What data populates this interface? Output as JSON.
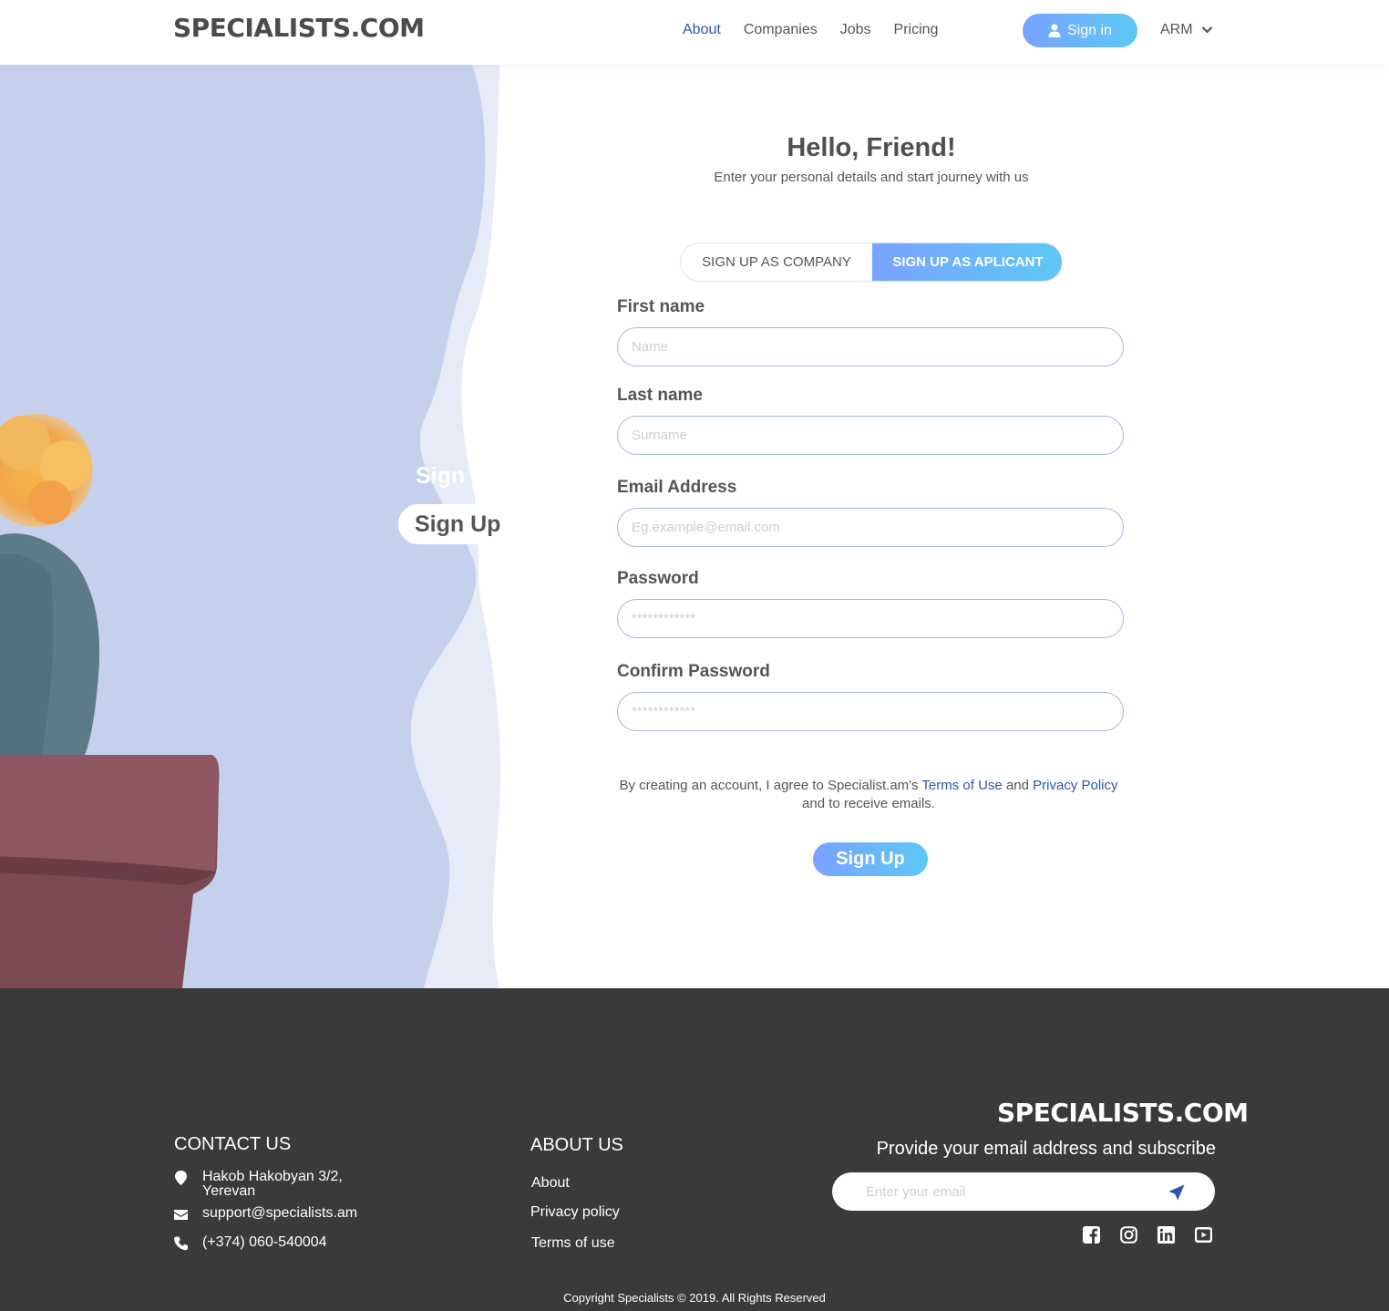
{
  "header": {
    "logo": "SPECIALISTS.COM",
    "nav": [
      "About",
      "Companies",
      "Jobs",
      "Pricing"
    ],
    "active_nav": "About",
    "signin_label": "Sign in",
    "language": "ARM"
  },
  "side_panel": {
    "signin_label": "Sign In",
    "signup_label": "Sign Up"
  },
  "form": {
    "title": "Hello, Friend!",
    "subtitle": "Enter your personal details and start journey with us",
    "tab_company": "SIGN UP AS COMPANY",
    "tab_applicant": "SIGN UP AS APLICANT",
    "first_name_label": "First name",
    "first_name_placeholder": "Name",
    "last_name_label": "Last name",
    "last_name_placeholder": "Surname",
    "email_label": "Email Address",
    "email_placeholder": "Eg.example@email.com",
    "password_label": "Password",
    "password_placeholder": "************",
    "confirm_label": "Confirm Password",
    "confirm_placeholder": "************",
    "agree_text_1": "By creating an account, I agree to Specialist.am's ",
    "terms_link": "Terms of Use",
    "agree_text_2": " and ",
    "privacy_link": "Privacy Policy",
    "agree_text_3": " and to receive emails.",
    "submit_label": "Sign Up"
  },
  "footer": {
    "contact_heading": "CONTACT US",
    "address_line1": "Hakob Hakobyan 3/2,",
    "address_line2": "Yerevan",
    "email": "support@specialists.am",
    "phone": "(+374) 060-540004",
    "about_heading": "ABOUT US",
    "about_links": [
      "About",
      "Privacy policy",
      "Terms of use"
    ],
    "logo": "SPECIALISTS.COM",
    "subscribe_text": "Provide your email address and subscribe",
    "subscribe_placeholder": "Enter your email",
    "social": [
      "facebook-icon",
      "instagram-icon",
      "linkedin-icon",
      "youtube-icon"
    ],
    "copyright": "Copyright Specialists © 2019. All Rights Reserved"
  },
  "colors": {
    "accent_blue": "#2b56a8",
    "gradient_start": "#7aa2ff",
    "gradient_end": "#5cc8f4",
    "footer_bg": "#3a3a3a",
    "panel_blue": "#c5d1ec"
  }
}
